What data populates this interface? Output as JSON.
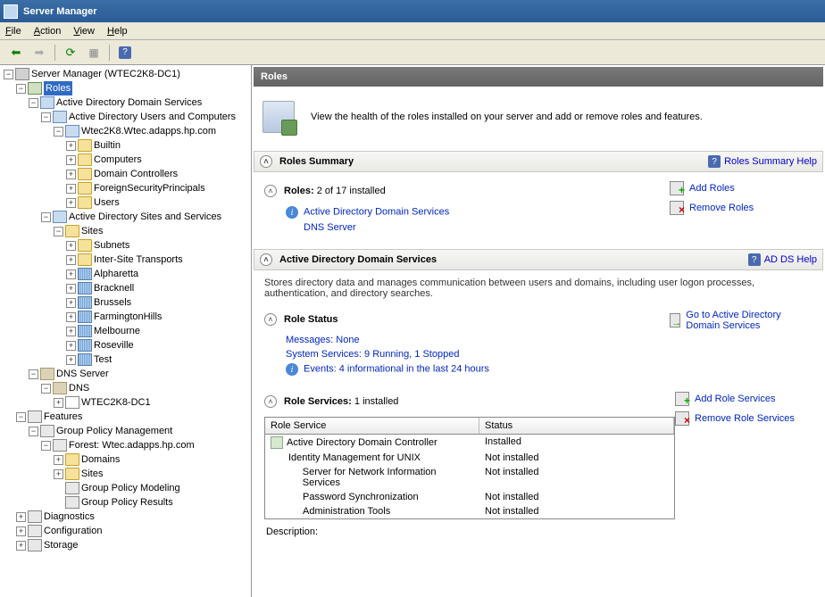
{
  "title": "Server Manager",
  "menu": {
    "file": "File",
    "action": "Action",
    "view": "View",
    "help": "Help"
  },
  "tree": {
    "root": "Server Manager (WTEC2K8-DC1)",
    "roles": "Roles",
    "adds": "Active Directory Domain Services",
    "aduc": "Active Directory Users and Computers",
    "domain": "Wtec2K8.Wtec.adapps.hp.com",
    "builtin": "Builtin",
    "computers": "Computers",
    "dcs": "Domain Controllers",
    "fsp": "ForeignSecurityPrincipals",
    "users": "Users",
    "adss": "Active Directory Sites and Services",
    "sitesFolder": "Sites",
    "subnets": "Subnets",
    "ist": "Inter-Site Transports",
    "sites": [
      "Alpharetta",
      "Bracknell",
      "Brussels",
      "FarmingtonHills",
      "Melbourne",
      "Roseville",
      "Test"
    ],
    "dnsServer": "DNS Server",
    "dns": "DNS",
    "dnsHost": "WTEC2K8-DC1",
    "features": "Features",
    "gpm": "Group Policy Management",
    "forest": "Forest: Wtec.adapps.hp.com",
    "domains": "Domains",
    "gpSites": "Sites",
    "gpModel": "Group Policy Modeling",
    "gpResults": "Group Policy Results",
    "diag": "Diagnostics",
    "config": "Configuration",
    "storage": "Storage"
  },
  "content": {
    "header": "Roles",
    "bannerText": "View the health of the roles installed on your server and add or remove roles and features.",
    "summaryHead": "Roles Summary",
    "summaryHelp": "Roles Summary Help",
    "rolesLabel": "Roles:",
    "rolesCount": "2 of 17 installed",
    "addRoles": "Add Roles",
    "removeRoles": "Remove Roles",
    "roleLinks": [
      "Active Directory Domain Services",
      "DNS Server"
    ],
    "addsHead": "Active Directory Domain Services",
    "addsHelp": "AD DS Help",
    "addsDesc": "Stores directory data and manages communication between users and domains, including user logon processes, authentication, and directory searches.",
    "roleStatusHead": "Role Status",
    "goAdds": "Go to Active Directory Domain Services",
    "messagesLabel": "Messages:",
    "messagesVal": "None",
    "sysSvcLabel": "System Services:",
    "sysSvcVal": "9 Running, 1 Stopped",
    "eventsLabel": "Events:",
    "eventsVal": "4 informational in the last 24 hours",
    "roleServicesHead": "Role Services:",
    "roleServicesCount": "1 installed",
    "addRoleSvc": "Add Role Services",
    "removeRoleSvc": "Remove Role Services",
    "tableCols": {
      "c1": "Role Service",
      "c2": "Status"
    },
    "rows": [
      {
        "name": "Active Directory Domain Controller",
        "status": "Installed",
        "indent": 0,
        "icon": true
      },
      {
        "name": "Identity Management for UNIX",
        "status": "Not installed",
        "indent": 0,
        "icon": false
      },
      {
        "name": "Server for Network Information Services",
        "status": "Not installed",
        "indent": 1,
        "icon": false
      },
      {
        "name": "Password Synchronization",
        "status": "Not installed",
        "indent": 1,
        "icon": false
      },
      {
        "name": "Administration Tools",
        "status": "Not installed",
        "indent": 1,
        "icon": false
      }
    ],
    "descriptionLabel": "Description:"
  }
}
